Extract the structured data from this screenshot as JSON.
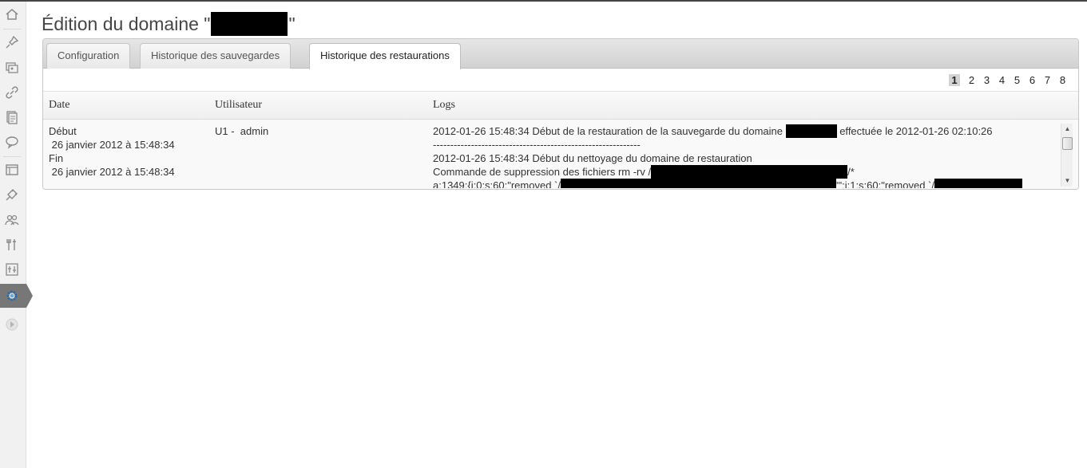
{
  "page": {
    "title_prefix": "Édition du domaine \"",
    "title_suffix": "\""
  },
  "sidebar": {
    "items": [
      {
        "icon": "dashboard-icon"
      },
      {
        "icon": "pin-icon"
      },
      {
        "icon": "media-icon"
      },
      {
        "icon": "links-icon"
      },
      {
        "icon": "pages-icon"
      },
      {
        "icon": "comments-icon"
      },
      {
        "icon": "appearance-icon"
      },
      {
        "icon": "plugins-icon"
      },
      {
        "icon": "users-icon"
      },
      {
        "icon": "tools-icon"
      },
      {
        "icon": "settings-icon"
      },
      {
        "icon": "gear-icon",
        "active": true
      },
      {
        "icon": "collapse-icon"
      }
    ],
    "active_color": "#777777"
  },
  "tabs": [
    {
      "label": "Configuration"
    },
    {
      "label": "Historique des sauvegardes"
    },
    {
      "label": "Historique des restaurations",
      "active": true
    }
  ],
  "pagination": {
    "pages": [
      "1",
      "2",
      "3",
      "4",
      "5",
      "6",
      "7",
      "8"
    ],
    "current": "1"
  },
  "table": {
    "headers": [
      "Date",
      "Utilisateur",
      "Logs"
    ],
    "row": {
      "start_label": "Début",
      "start_date": " 26 janvier 2012 à 15:48:34",
      "end_label": "Fin",
      "end_date": " 26 janvier 2012 à 15:48:34",
      "user": "U1 -  admin",
      "logs": {
        "line1_a": "2012-01-26 15:48:34 Début de la restauration de la sauvegarde du domaine ",
        "line1_b": " effectuée le 2012-01-26 02:10:26",
        "line2": "------------------------------------------------------------",
        "line3": "2012-01-26 15:48:34 Début du nettoyage du domaine de restauration",
        "line4_a": "Commande de suppression des fichiers rm -rv /",
        "line4_b": "/*",
        "line5_a": "a:1349:{i:0;s:60:\"removed `/",
        "line5_b": "'\";i:1;s:60:\"removed `/"
      }
    }
  }
}
